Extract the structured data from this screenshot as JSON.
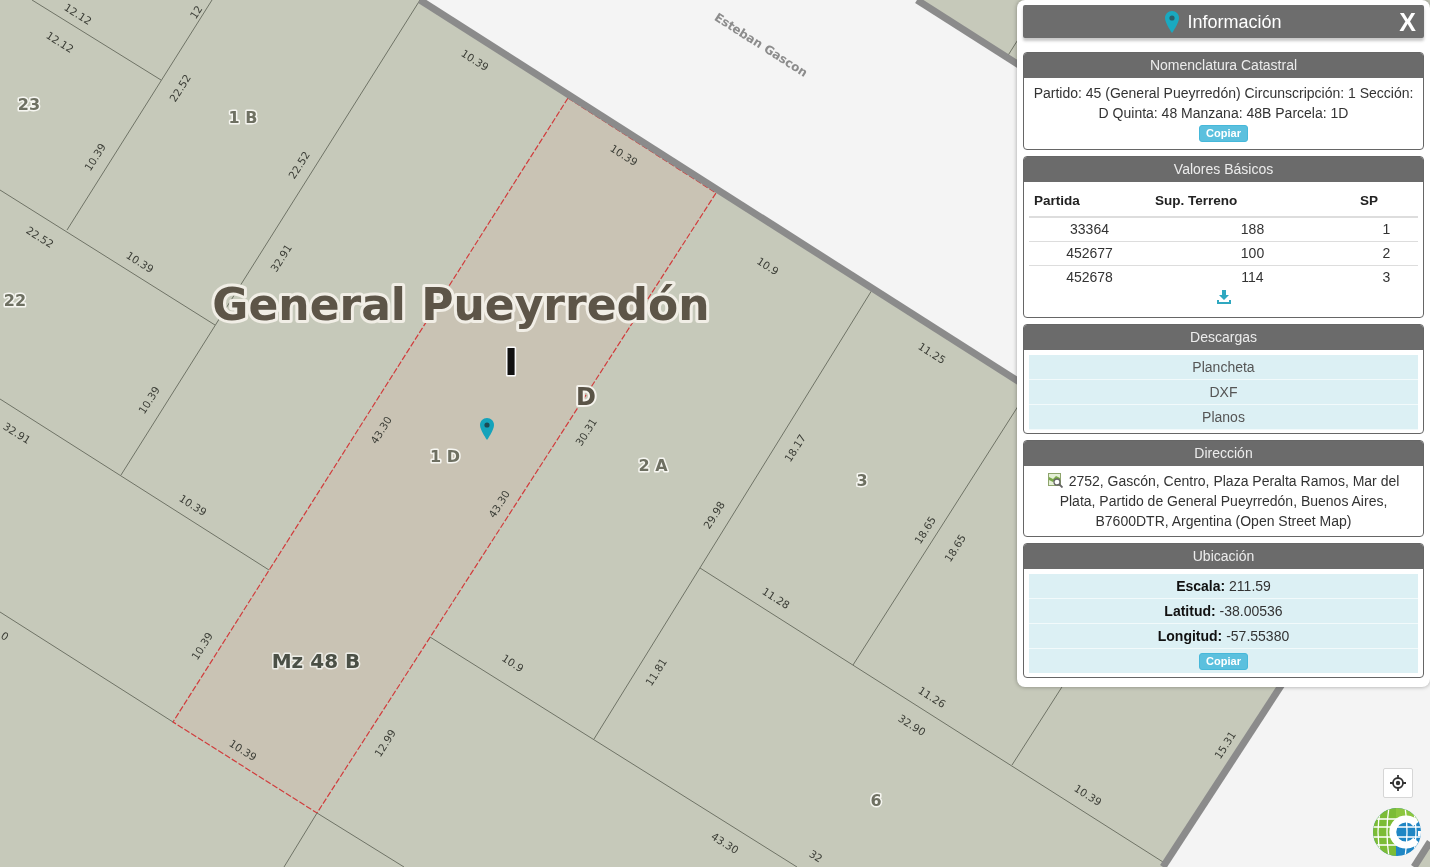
{
  "map": {
    "street_name": "Esteban Gascon",
    "municipality_label": "General Pueyrredón",
    "circunscripcion_label": "I",
    "seccion_label": "D",
    "manzana_label": "Mz 48 B",
    "parcel_labels": [
      "23",
      "1 B",
      "22",
      "1 D",
      "2 A",
      "3",
      "6"
    ],
    "dimension_labels": [
      "12.12",
      "12",
      "12.12",
      "10.39",
      "22.52",
      "10.39",
      "10.39",
      "22.52",
      "22.52",
      "32.91",
      "10.39",
      "10.9",
      "11.25",
      "10.39",
      "43.30",
      "30.31",
      "32.91",
      "18.17",
      "10.39",
      "43.30",
      "29.98",
      "18.65",
      "18.65",
      "11.28",
      "0",
      "10.39",
      "10.9",
      "11.81",
      "11.26",
      "32.90",
      "12.99",
      "15.31",
      "10.39",
      "10.39",
      "43.30",
      "32"
    ]
  },
  "info_panel": {
    "title": "Información",
    "close": "X",
    "sections": [
      {
        "kind": "text",
        "title": "Nomenclatura Catastral",
        "text": "Partido: 45 (General Pueyrredón) Circunscripción: 1 Sección: D Quinta: 48 Manzana: 48B Parcela: 1D",
        "button": "Copiar"
      },
      {
        "kind": "table",
        "title": "Valores Básicos",
        "columns": [
          "Partida",
          "Sup. Terreno",
          "SP"
        ],
        "rows": [
          [
            "33364",
            "188",
            "1"
          ],
          [
            "452677",
            "100",
            "2"
          ],
          [
            "452678",
            "114",
            "3"
          ]
        ]
      },
      {
        "kind": "links",
        "title": "Descargas",
        "items": [
          "Plancheta",
          "DXF",
          "Planos"
        ]
      },
      {
        "kind": "address",
        "title": "Dirección",
        "text": "2752, Gascón, Centro, Plaza Peralta Ramos, Mar del Plata, Partido de General Pueyrredón, Buenos Aires, B7600DTR, Argentina (Open Street Map)"
      },
      {
        "kind": "fields",
        "title": "Ubicación",
        "fields": [
          "**Escala:** 211.59",
          "**Latitud:** -38.00536",
          "**Longitud:** -57.55380"
        ],
        "button": "Copiar"
      }
    ]
  }
}
